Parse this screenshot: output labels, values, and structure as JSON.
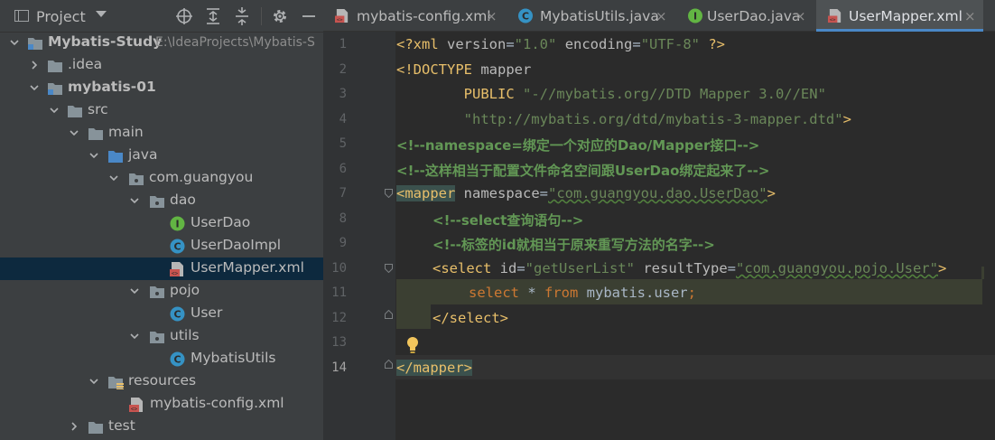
{
  "project_panel": {
    "title": "Project",
    "tree": [
      {
        "label": "Mybatis-Study",
        "path": "E:\\IdeaProjects\\Mybatis-S",
        "bold": true
      },
      {
        "label": ".idea"
      },
      {
        "label": "mybatis-01",
        "bold": true
      },
      {
        "label": "src"
      },
      {
        "label": "main"
      },
      {
        "label": "java"
      },
      {
        "label": "com.guangyou"
      },
      {
        "label": "dao"
      },
      {
        "label": "UserDao"
      },
      {
        "label": "UserDaoImpl"
      },
      {
        "label": "UserMapper.xml",
        "selected": true
      },
      {
        "label": "pojo"
      },
      {
        "label": "User"
      },
      {
        "label": "utils"
      },
      {
        "label": "MybatisUtils"
      },
      {
        "label": "resources"
      },
      {
        "label": "mybatis-config.xml"
      },
      {
        "label": "test"
      }
    ]
  },
  "tabs": [
    {
      "label": "mybatis-config.xml",
      "close": "×",
      "icon": "xml-file-icon"
    },
    {
      "label": "MybatisUtils.java",
      "close": "×",
      "icon": "class-icon"
    },
    {
      "label": "UserDao.java",
      "close": "×",
      "icon": "interface-icon"
    },
    {
      "label": "UserMapper.xml",
      "close": "×",
      "icon": "xml-file-icon",
      "active": true
    }
  ],
  "editor": {
    "line_numbers": [
      "1",
      "2",
      "3",
      "4",
      "5",
      "6",
      "7",
      "8",
      "9",
      "10",
      "11",
      "12",
      "13",
      "14"
    ],
    "lines": {
      "l1_a": "<?xml ",
      "l1_b": "version",
      "l1_c": "=",
      "l1_d": "\"1.0\"",
      "l1_e": " ",
      "l1_f": "encoding",
      "l1_g": "=",
      "l1_h": "\"UTF-8\"",
      "l1_i": " ?>",
      "l2_a": "<!DOCTYPE ",
      "l2_b": "mapper",
      "l3_a": "        PUBLIC ",
      "l3_b": "\"-//mybatis.org//DTD Mapper 3.0//EN\"",
      "l4_a": "        ",
      "l4_b": "\"http://mybatis.org/dtd/mybatis-3-mapper.dtd\"",
      "l4_c": ">",
      "l5": "<!--namespace=绑定一个对应的Dao/Mapper接口-->",
      "l6": "<!--这样相当于配置文件命名空间跟UserDao绑定起来了-->",
      "l7_a": "<mapper",
      "l7_b": " namespace",
      "l7_c": "=",
      "l7_d": "\"com.guangyou.dao.UserDao\"",
      "l7_e": ">",
      "l8": "<!--select查询语句-->",
      "l9": "<!--标签的id就相当于原来重写方法的名字-->",
      "l10_a": "<select ",
      "l10_b": "id",
      "l10_c": "=",
      "l10_d": "\"getUserList\"",
      "l10_e": " resultType",
      "l10_f": "=",
      "l10_g": "\"com.guangyou.pojo.User\"",
      "l10_h": ">",
      "l11_a": "select",
      "l11_b": " * ",
      "l11_c": "from",
      "l11_d": " mybatis.user",
      "l11_e": ";",
      "l12": "</select>",
      "l14": "</mapper>"
    }
  },
  "colors": {
    "tag": "#e8bf6a",
    "attribute": "#bababa",
    "string": "#6a8759",
    "comment": "#629755",
    "keyword": "#cc7832",
    "selection": "#0d293e",
    "active_tab_underline": "#4a88c7"
  }
}
